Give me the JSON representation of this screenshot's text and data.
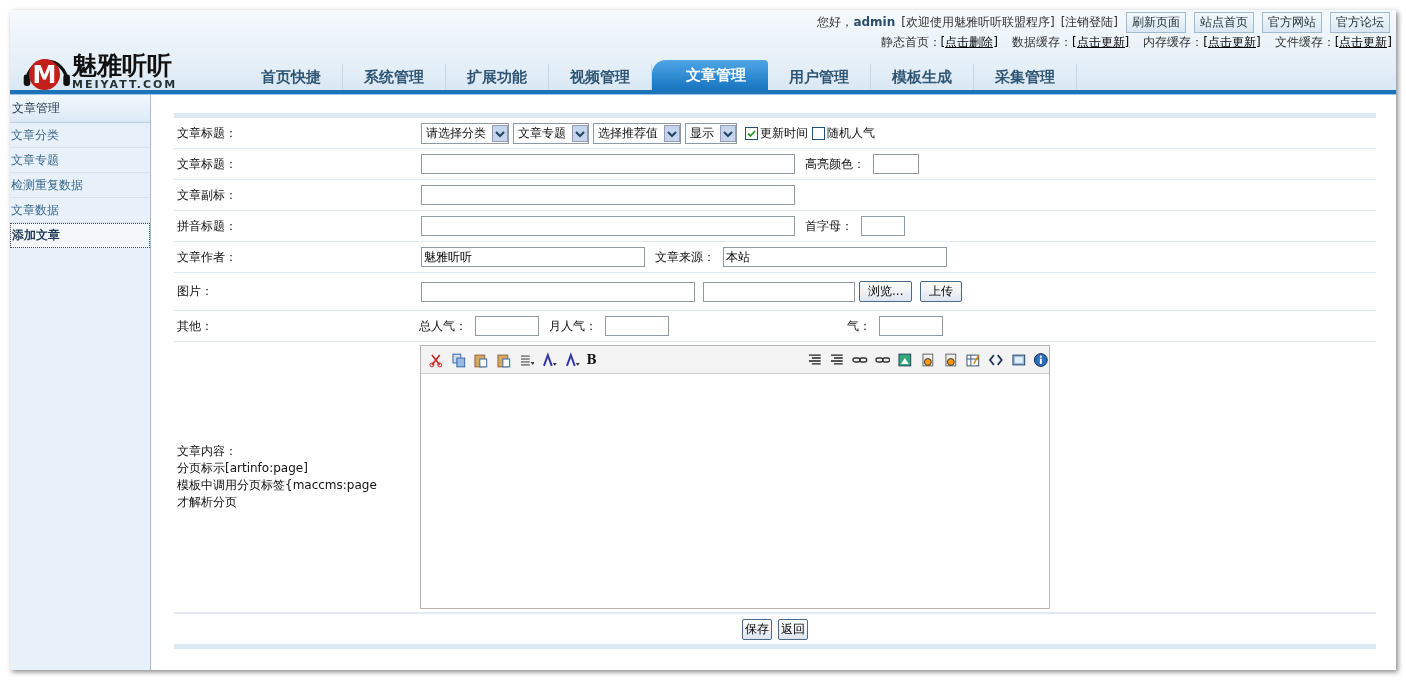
{
  "logo": {
    "mark": "M",
    "name": "魅雅听听",
    "domain": "MEIYATT.COM"
  },
  "user_bar": {
    "greeting": "您好，",
    "user": "admin",
    "welcome": "[欢迎使用魅雅听听联盟程序]",
    "logout": "[注销登陆]",
    "buttons": [
      "刷新页面",
      "站点首页",
      "官方网站",
      "官方论坛"
    ]
  },
  "cache_bar": [
    {
      "label": "静态首页：",
      "link": "[点击删除]"
    },
    {
      "label": "数据缓存：",
      "link": "[点击更新]"
    },
    {
      "label": "内存缓存：",
      "link": "[点击更新]"
    },
    {
      "label": "文件缓存：",
      "link": "[点击更新]"
    }
  ],
  "nav": [
    {
      "label": "首页快捷",
      "selected": false
    },
    {
      "label": "系统管理",
      "selected": false
    },
    {
      "label": "扩展功能",
      "selected": false
    },
    {
      "label": "视频管理",
      "selected": false
    },
    {
      "label": "文章管理",
      "selected": true
    },
    {
      "label": "用户管理",
      "selected": false
    },
    {
      "label": "模板生成",
      "selected": false
    },
    {
      "label": "采集管理",
      "selected": false
    }
  ],
  "sidebar": {
    "title": "文章管理",
    "items": [
      {
        "label": "文章分类",
        "selected": false
      },
      {
        "label": "文章专题",
        "selected": false
      },
      {
        "label": "检测重复数据",
        "selected": false
      },
      {
        "label": "文章数据",
        "selected": false
      },
      {
        "label": "添加文章",
        "selected": true
      }
    ]
  },
  "form": {
    "rows": [
      {
        "label": "文章标题：",
        "kind": "options",
        "selects": [
          "请选择分类",
          "文章专题",
          "选择推荐值",
          "显示"
        ],
        "checks": [
          {
            "label": "更新时间",
            "checked": true
          },
          {
            "label": "随机人气",
            "checked": false
          }
        ]
      },
      {
        "label": "文章标题：",
        "kind": "fields",
        "fields": [
          {
            "kind": "input"
          },
          {
            "kind": "input",
            "label": "高亮颜色："
          }
        ]
      },
      {
        "label": "文章副标：",
        "kind": "fields",
        "fields": [
          {
            "kind": "input"
          }
        ]
      },
      {
        "label": "拼音标题：",
        "kind": "fields",
        "fields": [
          {
            "kind": "input"
          },
          {
            "kind": "input",
            "label": "首字母："
          }
        ]
      },
      {
        "label": "文章作者：",
        "kind": "fields",
        "fields": [
          {
            "kind": "input",
            "value": "魅雅听听"
          },
          {
            "kind": "input",
            "label": "文章来源：",
            "value": "本站"
          }
        ]
      },
      {
        "label": "图片：",
        "kind": "fields",
        "fields": [
          {
            "kind": "input"
          },
          {
            "kind": "file",
            "button": "浏览..."
          },
          {
            "kind": "button",
            "text": "上传"
          }
        ]
      },
      {
        "label": "其他：",
        "kind": "fields",
        "fields": [
          {
            "kind": "input",
            "label": "总人气："
          },
          {
            "kind": "input",
            "label": "月人气："
          },
          {
            "kind": "input",
            "label": "气："
          }
        ]
      },
      {
        "kind": "editor",
        "label_lines": [
          "文章内容：",
          "分页标示[artinfo:page]",
          "模板中调用分页标签{maccms:page",
          "才解析分页"
        ],
        "bold_button": "B"
      }
    ],
    "buttons": [
      "保存",
      "返回"
    ]
  }
}
